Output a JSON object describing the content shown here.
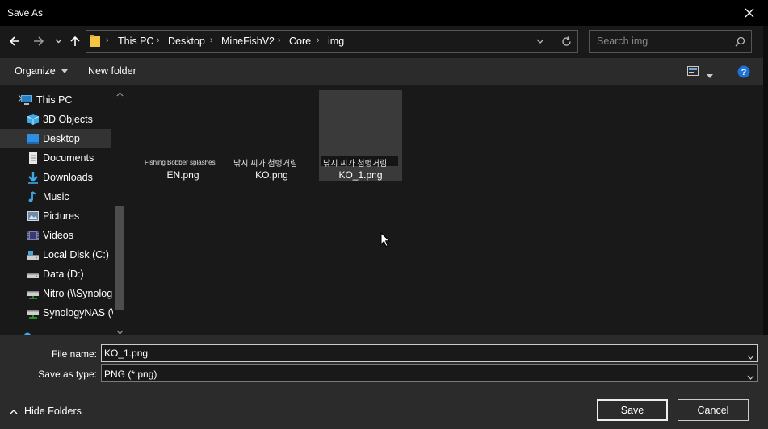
{
  "window": {
    "title": "Save As"
  },
  "nav": {
    "breadcrumbs": [
      "This PC",
      "Desktop",
      "MineFishV2",
      "Core",
      "img"
    ],
    "search_placeholder": "Search img"
  },
  "toolbar": {
    "organize_label": "Organize",
    "new_folder_label": "New folder"
  },
  "sidebar": {
    "items": [
      {
        "label": "This PC",
        "icon": "pc-icon"
      },
      {
        "label": "3D Objects",
        "icon": "cube-icon"
      },
      {
        "label": "Desktop",
        "icon": "desktop-icon",
        "selected": true
      },
      {
        "label": "Documents",
        "icon": "documents-icon"
      },
      {
        "label": "Downloads",
        "icon": "download-icon"
      },
      {
        "label": "Music",
        "icon": "music-icon"
      },
      {
        "label": "Pictures",
        "icon": "pictures-icon"
      },
      {
        "label": "Videos",
        "icon": "videos-icon"
      },
      {
        "label": "Local Disk (C:)",
        "icon": "drive-icon"
      },
      {
        "label": "Data (D:)",
        "icon": "drive-icon"
      },
      {
        "label": "Nitro (\\\\Synolog",
        "icon": "network-drive-icon"
      },
      {
        "label": "SynologyNAS (\\\\",
        "icon": "network-drive-icon"
      }
    ]
  },
  "files": [
    {
      "name": "EN.png",
      "thumb_text": "Fishing Bobber splashes"
    },
    {
      "name": "KO.png",
      "thumb_text": "낚시 찌가 첨벙거림"
    },
    {
      "name": "KO_1.png",
      "thumb_text": "낚시 찌가 첨벙거림",
      "selected": true
    }
  ],
  "form": {
    "file_name_label": "File name:",
    "file_name_value": "KO_1.png",
    "save_type_label": "Save as type:",
    "save_type_value": "PNG (*.png)"
  },
  "footer": {
    "hide_folders_label": "Hide Folders",
    "save_label": "Save",
    "cancel_label": "Cancel"
  },
  "colors": {
    "background": "#191919",
    "panel": "#2b2b2b",
    "titlebar": "#000000",
    "folder_yellow": "#f4c542",
    "help_blue": "#1e73d8"
  }
}
